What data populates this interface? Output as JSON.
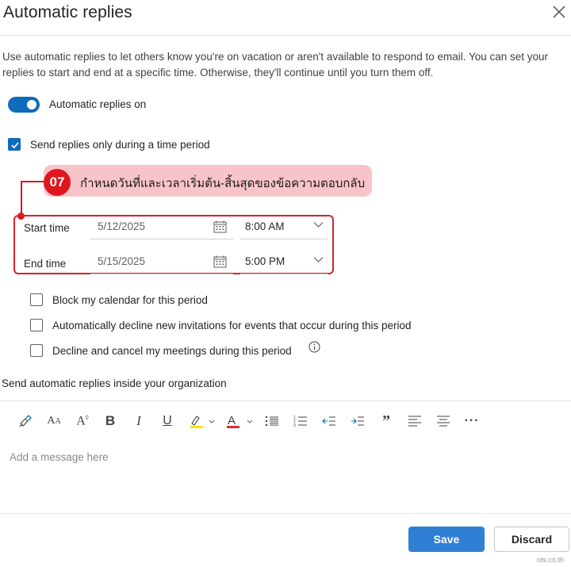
{
  "dialog": {
    "title": "Automatic replies",
    "description": "Use automatic replies to let others know you're on vacation or aren't available to respond to email. You can set your replies to start and end at a specific time. Otherwise, they'll continue until you turn them off."
  },
  "toggle": {
    "label": "Automatic replies on",
    "on": true
  },
  "time_period": {
    "label": "Send replies only during a time period",
    "checked": true
  },
  "callout": {
    "number": "07",
    "text": "กำหนดวันที่และเวลาเริ่มต้น-สิ้นสุดของข้อความตอบกลับ"
  },
  "start": {
    "label": "Start time",
    "date": "5/12/2025",
    "time": "8:00 AM"
  },
  "end": {
    "label": "End time",
    "date": "5/15/2025",
    "time": "5:00 PM"
  },
  "options": [
    {
      "label": "Block my calendar for this period",
      "checked": false
    },
    {
      "label": "Automatically decline new invitations for events that occur during this period",
      "checked": false
    },
    {
      "label": "Decline and cancel my meetings during this period",
      "checked": false
    }
  ],
  "inside_org": {
    "label": "Send automatic replies inside your organization"
  },
  "editor": {
    "placeholder": "Add a message here"
  },
  "toolbar_icons": [
    "format-painter-icon",
    "font-size-icon",
    "text-effects-icon",
    "bold-icon",
    "italic-icon",
    "underline-icon",
    "highlight-icon",
    "font-color-icon",
    "bullets-icon",
    "numbering-icon",
    "decrease-indent-icon",
    "increase-indent-icon",
    "quote-icon",
    "align-left-icon",
    "align-center-icon",
    "more-icon"
  ],
  "buttons": {
    "save": "Save",
    "discard": "Discard"
  },
  "watermark": "nts.co.th",
  "colors": {
    "accent": "#0f6cbd",
    "save_button": "#2f7fd4",
    "callout_bg": "#f8c4ca",
    "callout_red": "#e0151d"
  }
}
